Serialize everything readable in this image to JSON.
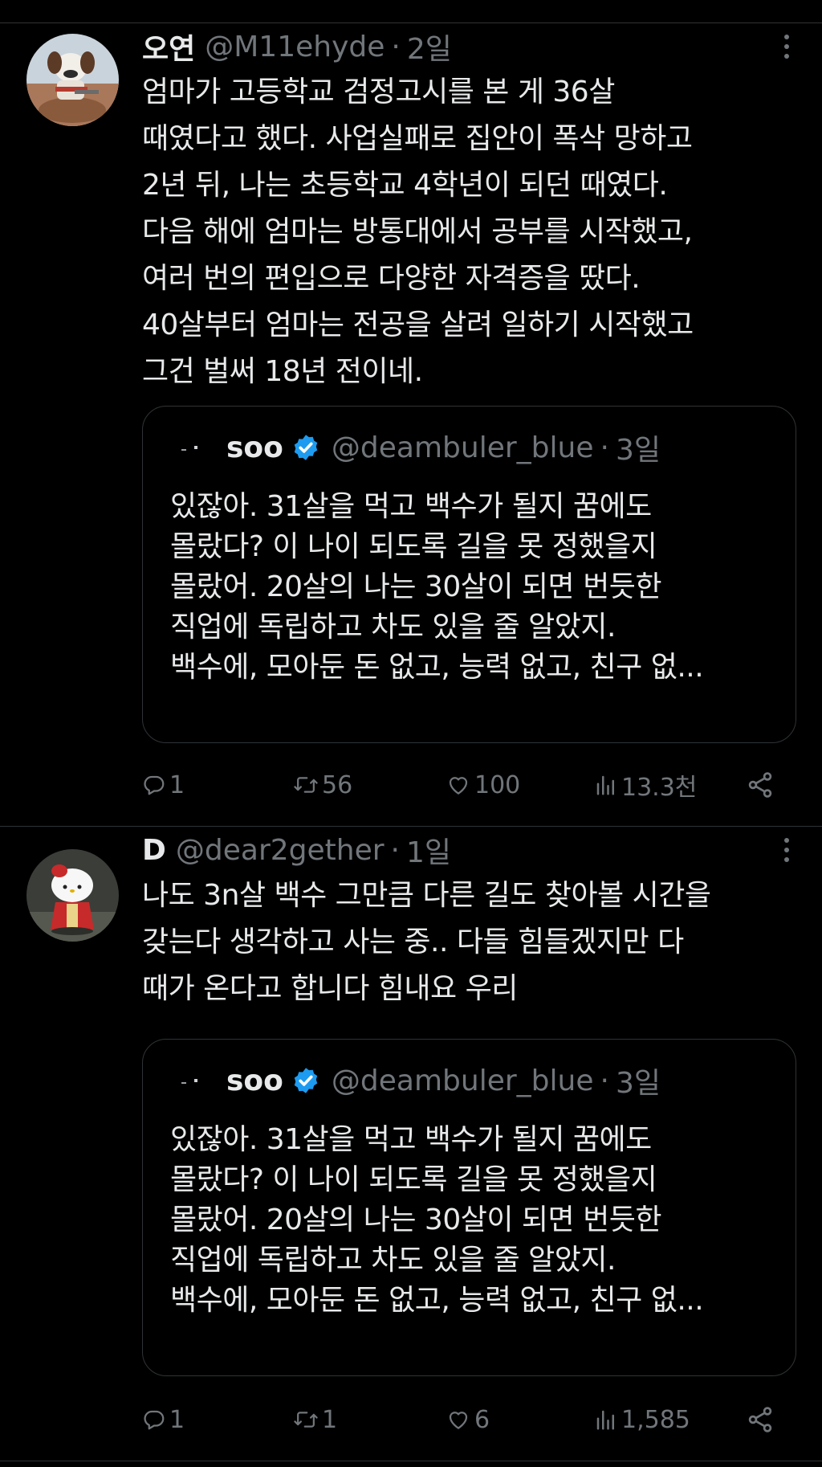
{
  "tweets": [
    {
      "display_name": "오연",
      "handle": "@M11ehyde",
      "separator": "·",
      "time": "2일",
      "text_lines": [
        "엄마가 고등학교 검정고시를 본 게 36살",
        "때였다고 했다. 사업실패로 집안이 폭삭 망하고",
        "2년 뒤, 나는 초등학교 4학년이 되던 때였다.",
        "다음 해에 엄마는 방통대에서 공부를 시작했고,",
        "여러 번의 편입으로 다양한 자격증을 땄다.",
        "40살부터 엄마는 전공을 살려 일하기 시작했고",
        "그건 벌써 18년 전이네."
      ],
      "quote": {
        "name": "soo",
        "handle": "@deambuler_blue",
        "separator": "·",
        "time": "3일",
        "text_lines": [
          "있잖아. 31살을 먹고 백수가 될지 꿈에도",
          "몰랐다? 이 나이 되도록 길을 못 정했을지",
          "몰랐어. 20살의 나는 30살이 되면 번듯한",
          "직업에 독립하고 차도 있을 줄 알았지.",
          "백수에, 모아둔 돈 없고, 능력 없고, 친구 없..."
        ]
      },
      "stats": {
        "replies": "1",
        "retweets": "56",
        "likes": "100",
        "views": "13.3천"
      }
    },
    {
      "display_name": "D",
      "handle": "@dear2gether",
      "separator": "·",
      "time": "1일",
      "text_lines": [
        "나도 3n살 백수 그만큼 다른 길도 찾아볼 시간을",
        "갖는다 생각하고 사는 중.. 다들 힘들겠지만 다",
        "때가 온다고 합니다 힘내요 우리"
      ],
      "quote": {
        "name": "soo",
        "handle": "@deambuler_blue",
        "separator": "·",
        "time": "3일",
        "text_lines": [
          "있잖아. 31살을 먹고 백수가 될지 꿈에도",
          "몰랐다? 이 나이 되도록 길을 못 정했을지",
          "몰랐어. 20살의 나는 30살이 되면 번듯한",
          "직업에 독립하고 차도 있을 줄 알았지.",
          "백수에, 모아둔 돈 없고, 능력 없고, 친구 없..."
        ]
      },
      "stats": {
        "replies": "1",
        "retweets": "1",
        "likes": "6",
        "views": "1,585"
      }
    }
  ],
  "icons": {
    "reply": "reply-icon",
    "retweet": "retweet-icon",
    "like": "heart-icon",
    "views": "views-icon",
    "share": "share-icon",
    "more": "more-icon",
    "verified": "verified-badge-icon"
  },
  "colors": {
    "background": "#000000",
    "text": "#e7e9ea",
    "secondary": "#71767b",
    "border": "#2f3336",
    "verified": "#1d9bf0"
  }
}
